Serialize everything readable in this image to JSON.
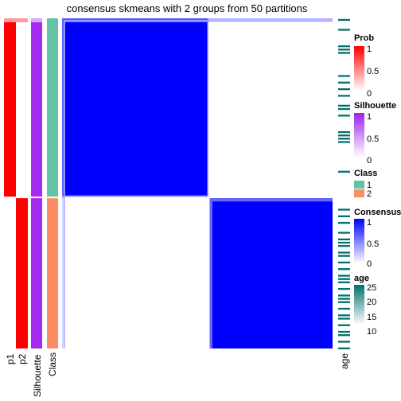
{
  "chart_data": {
    "type": "heatmap",
    "title": "consensus skmeans with 2 groups from 50 partitions",
    "n_samples_group1": 54,
    "n_samples_group2": 46,
    "consensus_matrix": {
      "description": "block-diagonal consensus matrix, samples ordered by class",
      "blocks": [
        {
          "rows": "group1",
          "cols": "group1",
          "value": 1
        },
        {
          "rows": "group1",
          "cols": "group2",
          "value": 0
        },
        {
          "rows": "group2",
          "cols": "group1",
          "value": 0
        },
        {
          "rows": "group2",
          "cols": "group2",
          "value": 1
        }
      ],
      "edge_sample_value": 0.3
    },
    "annotations": [
      {
        "name": "p1",
        "group1": 1,
        "group2": 0
      },
      {
        "name": "p2",
        "group1": 0,
        "group2": 1
      },
      {
        "name": "Silhouette",
        "group1": 0.95,
        "group2": 0.95
      },
      {
        "name": "Class",
        "group1": "1",
        "group2": "2"
      }
    ],
    "age_pattern": [
      1,
      0,
      0,
      1,
      0,
      0,
      0,
      0,
      1,
      1,
      1,
      0,
      0,
      0,
      0,
      0,
      0,
      1,
      0,
      1,
      0,
      1,
      0,
      1,
      0,
      0,
      1,
      1,
      0,
      1,
      0,
      0,
      0,
      0,
      1,
      1,
      1,
      1,
      0,
      0,
      0,
      0,
      0,
      0,
      0,
      0,
      1,
      0,
      0,
      0,
      0,
      0,
      0,
      0,
      0,
      0,
      0,
      1,
      0,
      1,
      0,
      1,
      0,
      0,
      1,
      0,
      1,
      1,
      1,
      0,
      1,
      1,
      0,
      1,
      0,
      1,
      0,
      1,
      1,
      1,
      0,
      1,
      0,
      1,
      1,
      1,
      0,
      1,
      0,
      1,
      1,
      0,
      1,
      0,
      1,
      1,
      0,
      1,
      0,
      1
    ],
    "bottom_labels": [
      "p1",
      "p2",
      "Silhouette",
      "Class"
    ],
    "right_label": "age",
    "legends": [
      {
        "title": "Prob",
        "type": "continuous",
        "ticks": [
          "1",
          "0.5",
          "0"
        ],
        "colors": [
          "#ff0000",
          "#ffffff"
        ]
      },
      {
        "title": "Silhouette",
        "type": "continuous",
        "ticks": [
          "1",
          "0.5",
          "0"
        ],
        "colors": [
          "#a020f0",
          "#ffffff"
        ]
      },
      {
        "title": "Class",
        "type": "discrete",
        "entries": [
          {
            "label": "1",
            "color": "#66c2a5"
          },
          {
            "label": "2",
            "color": "#fc8d62"
          }
        ]
      },
      {
        "title": "Consensus",
        "type": "continuous",
        "ticks": [
          "1",
          "0.5",
          "0"
        ],
        "colors": [
          "#0000ff",
          "#ffffff"
        ]
      },
      {
        "title": "age",
        "type": "continuous",
        "ticks": [
          "25",
          "20",
          "15",
          "10"
        ],
        "colors": [
          "#00706c",
          "#ffffff"
        ]
      }
    ]
  },
  "colors": {
    "prob": "#ff0000",
    "silhouette": "#a020f0",
    "class1": "#66c2a5",
    "class2": "#fc8d62",
    "consensus": "#0000ff",
    "age": "#00706c"
  }
}
